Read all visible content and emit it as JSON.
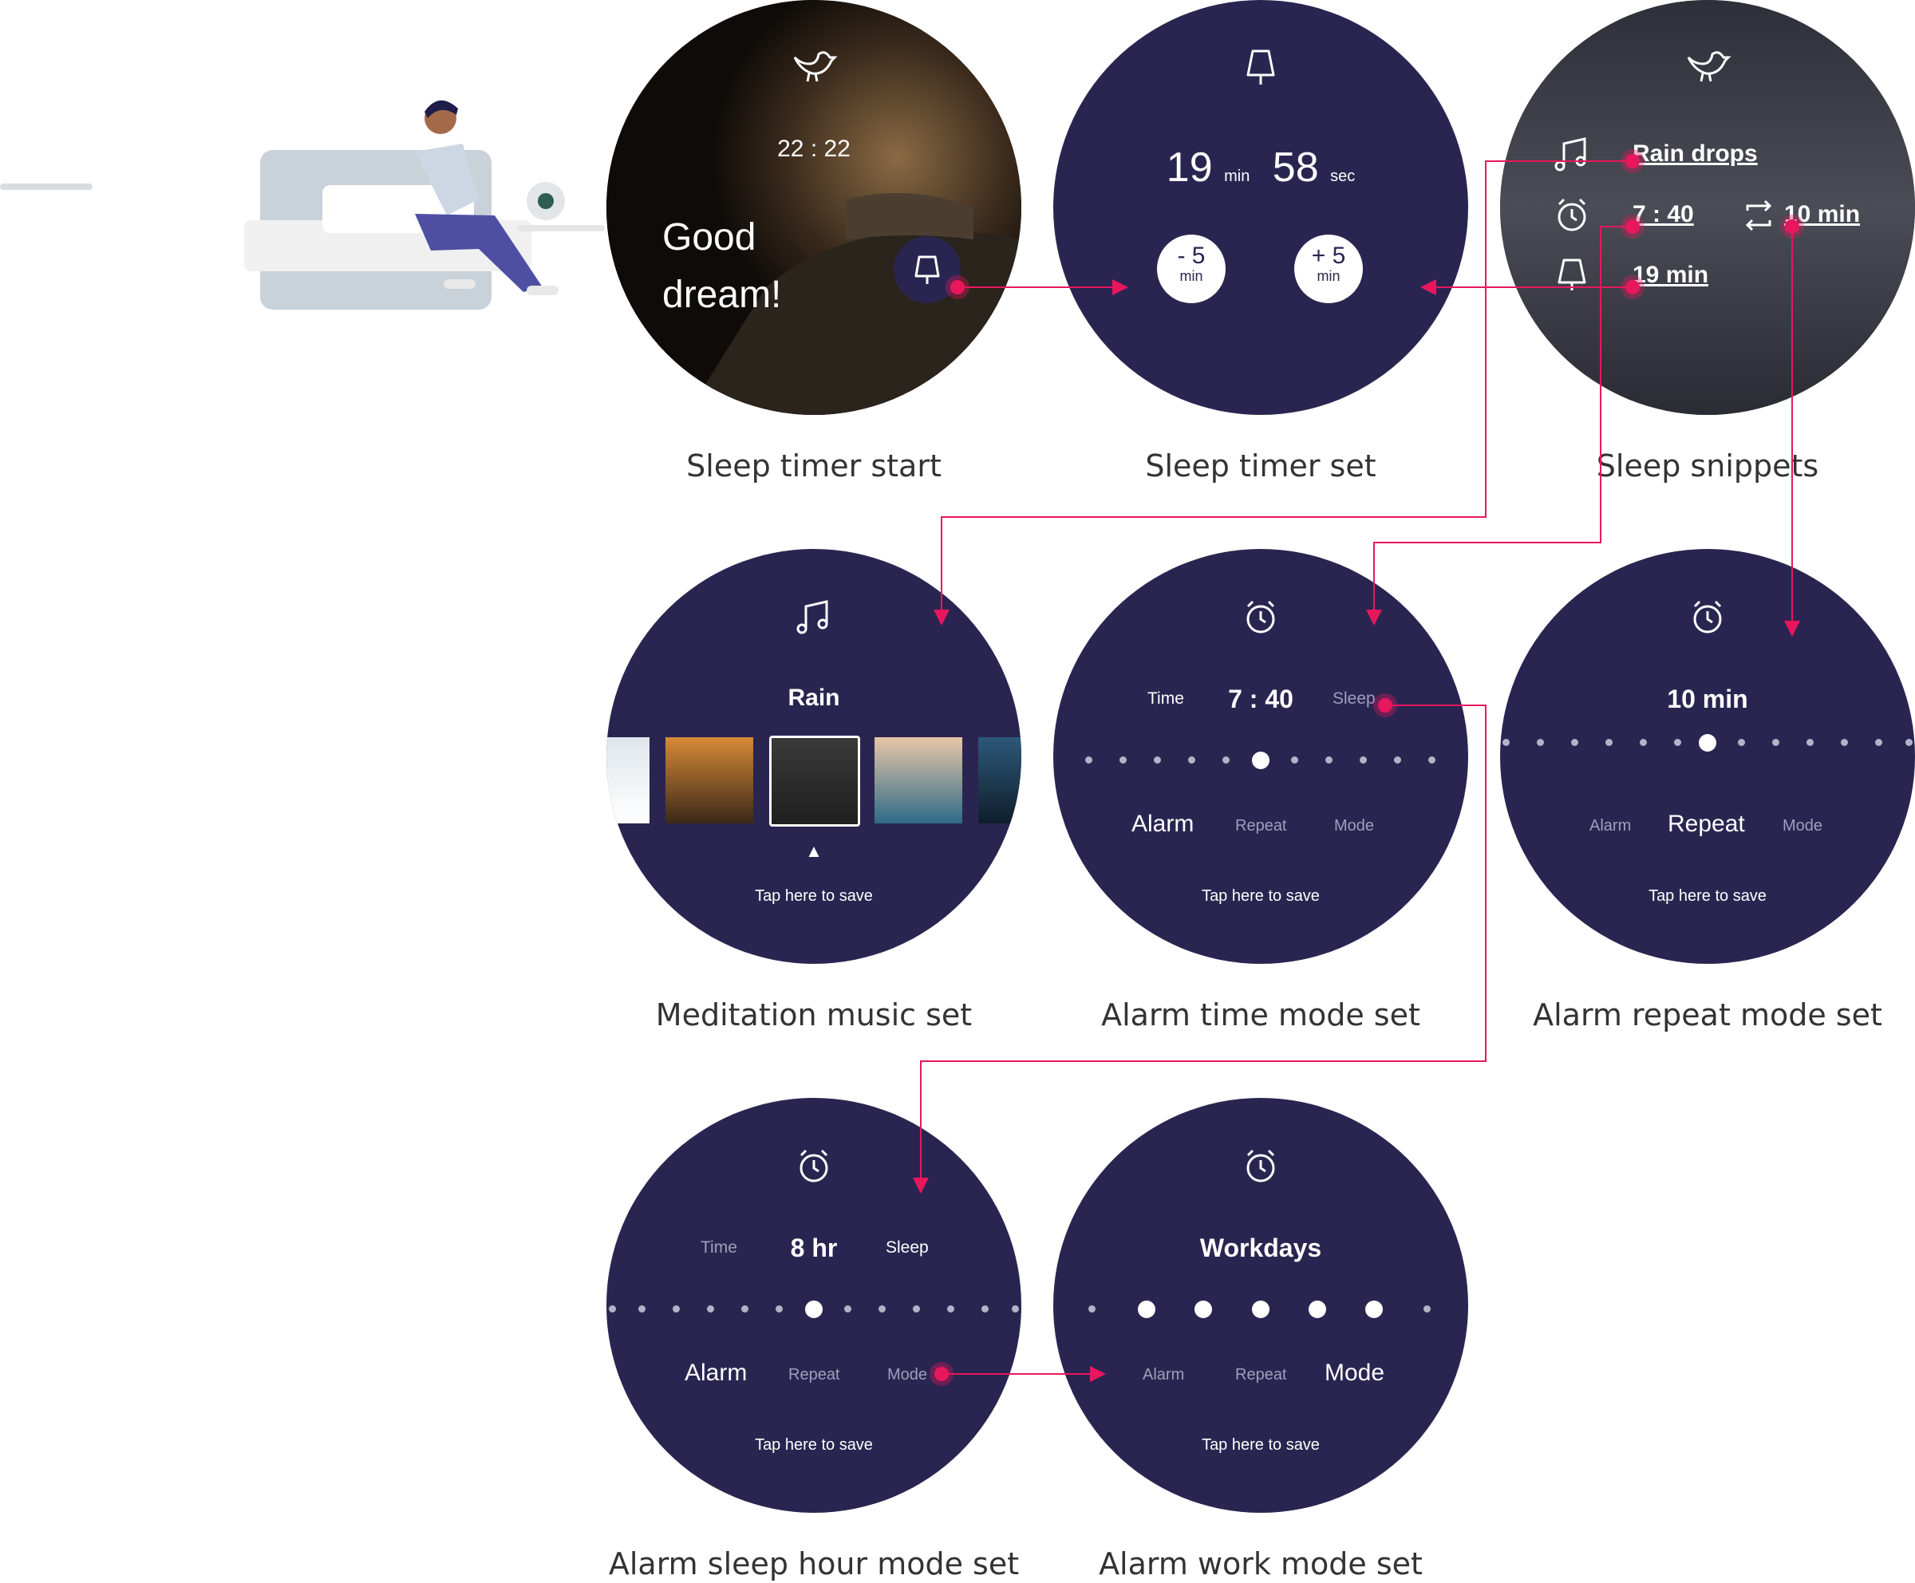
{
  "screens": {
    "start": {
      "time": "22 : 22",
      "greeting_line1": "Good",
      "greeting_line2": "dream!",
      "caption": "Sleep timer start"
    },
    "timer_set": {
      "minutes": "19",
      "min_unit": "min",
      "seconds": "58",
      "sec_unit": "sec",
      "minus_value": "- 5",
      "minus_unit": "min",
      "plus_value": "+ 5",
      "plus_unit": "min",
      "caption": "Sleep timer set"
    },
    "snippets": {
      "music": "Rain drops",
      "alarm_time": "7 : 40",
      "repeat": "10 min",
      "timer": "19 min",
      "caption": "Sleep snippets"
    },
    "music_set": {
      "title": "Rain",
      "save": "Tap here to save",
      "caption": "Meditation music set"
    },
    "alarm_time": {
      "left": "Time",
      "value": "7 : 40",
      "right": "Sleep",
      "mode_alarm": "Alarm",
      "mode_repeat": "Repeat",
      "mode_mode": "Mode",
      "save": "Tap here to save",
      "caption": "Alarm time mode set"
    },
    "alarm_repeat": {
      "value": "10 min",
      "mode_alarm": "Alarm",
      "mode_repeat": "Repeat",
      "mode_mode": "Mode",
      "save": "Tap here to save",
      "caption": "Alarm repeat mode set"
    },
    "alarm_sleep": {
      "left": "Time",
      "value": "8 hr",
      "right": "Sleep",
      "mode_alarm": "Alarm",
      "mode_repeat": "Repeat",
      "mode_mode": "Mode",
      "save": "Tap here to save",
      "caption": "Alarm sleep hour mode set"
    },
    "alarm_work": {
      "value": "Workdays",
      "mode_alarm": "Alarm",
      "mode_repeat": "Repeat",
      "mode_mode": "Mode",
      "save": "Tap here to save",
      "caption": "Alarm work mode set"
    }
  },
  "colors": {
    "watch_bg": "#2a2550",
    "accent": "#e8175d",
    "caption_text": "#333333"
  }
}
